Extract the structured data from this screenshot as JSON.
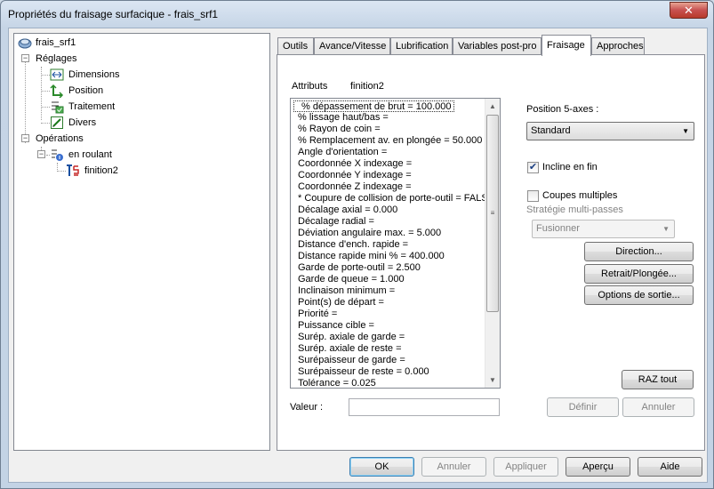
{
  "window": {
    "title": "Propriétés du fraisage surfacique - frais_srf1",
    "close_glyph": "✕"
  },
  "tree": {
    "root": "frais_srf1",
    "reglages": "Réglages",
    "dimensions": "Dimensions",
    "position": "Position",
    "traitement": "Traitement",
    "divers": "Divers",
    "operations": "Opérations",
    "en_roulant": "en roulant",
    "finition2": "finition2"
  },
  "tabs": [
    "Outils",
    "Avance/Vitesse",
    "Lubrification",
    "Variables post-pro",
    "Fraisage",
    "Approches"
  ],
  "active_tab": "Fraisage",
  "panel": {
    "attributs_label": "Attributs",
    "attributs_value": "finition2",
    "attributes": [
      "% dépassement de brut = 100.000",
      "% lissage haut/bas =",
      "% Rayon de coin =",
      "% Remplacement av. en plongée = 50.000",
      "Angle d'orientation =",
      "Coordonnée X indexage =",
      "Coordonnée Y indexage =",
      "Coordonnée Z indexage =",
      "* Coupure de collision de porte-outil = FALSE",
      "Décalage axial = 0.000",
      "Décalage radial =",
      "Déviation angulaire max. = 5.000",
      "Distance d'ench. rapide =",
      "Distance rapide mini % = 400.000",
      "Garde de porte-outil = 2.500",
      "Garde de queue = 1.000",
      "Inclinaison minimum =",
      "Point(s) de départ =",
      "Priorité =",
      "Puissance cible =",
      "Surép. axiale de garde =",
      "Surép. axiale de reste =",
      "Surépaisseur de garde =",
      "Surépaisseur de reste = 0.000",
      "Tolérance = 0.025"
    ],
    "valeur_label": "Valeur :",
    "valeur_value": "",
    "position5_label": "Position 5-axes :",
    "position5_value": "Standard",
    "incline_label": "Incline en fin",
    "incline_checked": true,
    "coupes_label": "Coupes multiples",
    "coupes_checked": false,
    "strategie_label": "Stratégie multi-passes",
    "strategie_value": "Fusionner",
    "direction_btn": "Direction...",
    "retrait_btn": "Retrait/Plongée...",
    "options_btn": "Options de sortie...",
    "raz_btn": "RAZ tout",
    "definir_btn": "Définir",
    "annuler_btn": "Annuler"
  },
  "footer": {
    "ok": "OK",
    "annuler": "Annuler",
    "appliquer": "Appliquer",
    "apercu": "Aperçu",
    "aide": "Aide"
  }
}
